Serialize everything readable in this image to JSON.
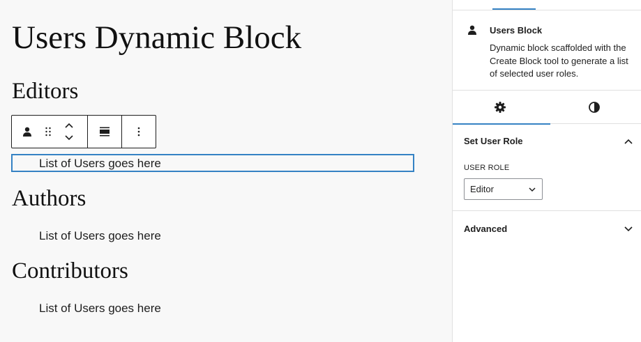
{
  "canvas": {
    "post_title": "Users Dynamic Block",
    "sections": [
      {
        "heading": "Editors",
        "text": "List of Users goes here"
      },
      {
        "heading": "Authors",
        "text": "List of Users goes here"
      },
      {
        "heading": "Contributors",
        "text": "List of Users goes here"
      }
    ]
  },
  "toolbar": {
    "icons": [
      "user-icon",
      "drag-handle-icon",
      "move-up-icon",
      "move-down-icon",
      "align-icon",
      "more-options-icon"
    ]
  },
  "sidebar": {
    "block_card": {
      "title": "Users Block",
      "description": "Dynamic block scaffolded with the Create Block tool to generate a list of selected user roles.",
      "icon": "user-icon"
    },
    "inspector_tabs": [
      {
        "icon": "settings-gear-icon",
        "active": true
      },
      {
        "icon": "styles-contrast-icon",
        "active": false
      }
    ],
    "panels": {
      "user_role": {
        "title": "Set User Role",
        "field_label": "USER ROLE",
        "selected": "Editor",
        "expanded": true
      },
      "advanced": {
        "title": "Advanced",
        "expanded": false
      }
    }
  },
  "colors": {
    "accent": "#3582c4",
    "text": "#1e1e1e",
    "canvas_bg": "#f8f8f8",
    "sidebar_bg": "#ffffff",
    "divider": "#e0e0e0"
  }
}
